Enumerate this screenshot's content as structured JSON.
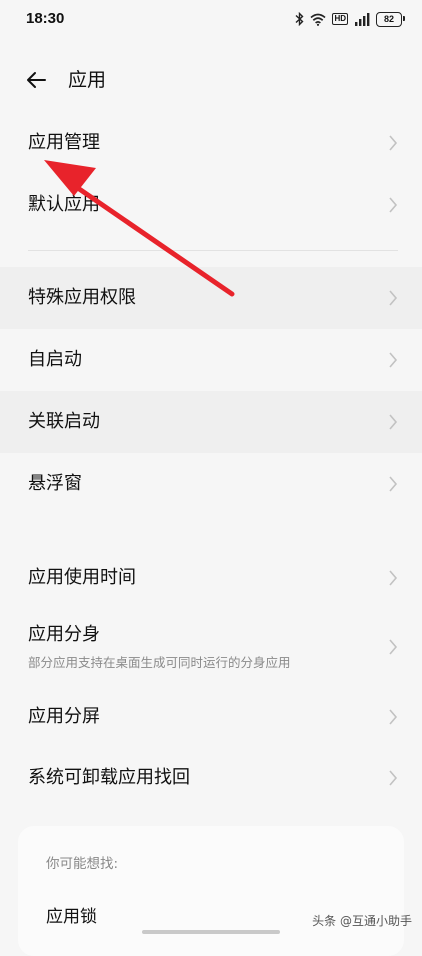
{
  "status_bar": {
    "time": "18:30",
    "battery": "82",
    "hd": "HD",
    "icons": [
      "bluetooth-icon",
      "wifi-icon",
      "hd-icon",
      "signal-icon",
      "battery-icon"
    ]
  },
  "header": {
    "back_icon": "arrow-left-icon",
    "title": "应用"
  },
  "group1": [
    {
      "label": "应用管理"
    },
    {
      "label": "默认应用"
    }
  ],
  "group2": [
    {
      "label": "特殊应用权限"
    },
    {
      "label": "自启动"
    },
    {
      "label": "关联启动"
    },
    {
      "label": "悬浮窗"
    }
  ],
  "group3": [
    {
      "label": "应用使用时间"
    },
    {
      "label": "应用分身",
      "sub": "部分应用支持在桌面生成可同时运行的分身应用"
    },
    {
      "label": "应用分屏"
    },
    {
      "label": "系统可卸载应用找回"
    }
  ],
  "suggestions": {
    "title": "你可能想找:",
    "items": [
      "应用锁"
    ]
  },
  "watermark": "头条 @互通小助手",
  "colors": {
    "background": "#f6f6f6",
    "annotation_arrow": "#e8232b",
    "secondary_text": "#8a8a8a"
  }
}
